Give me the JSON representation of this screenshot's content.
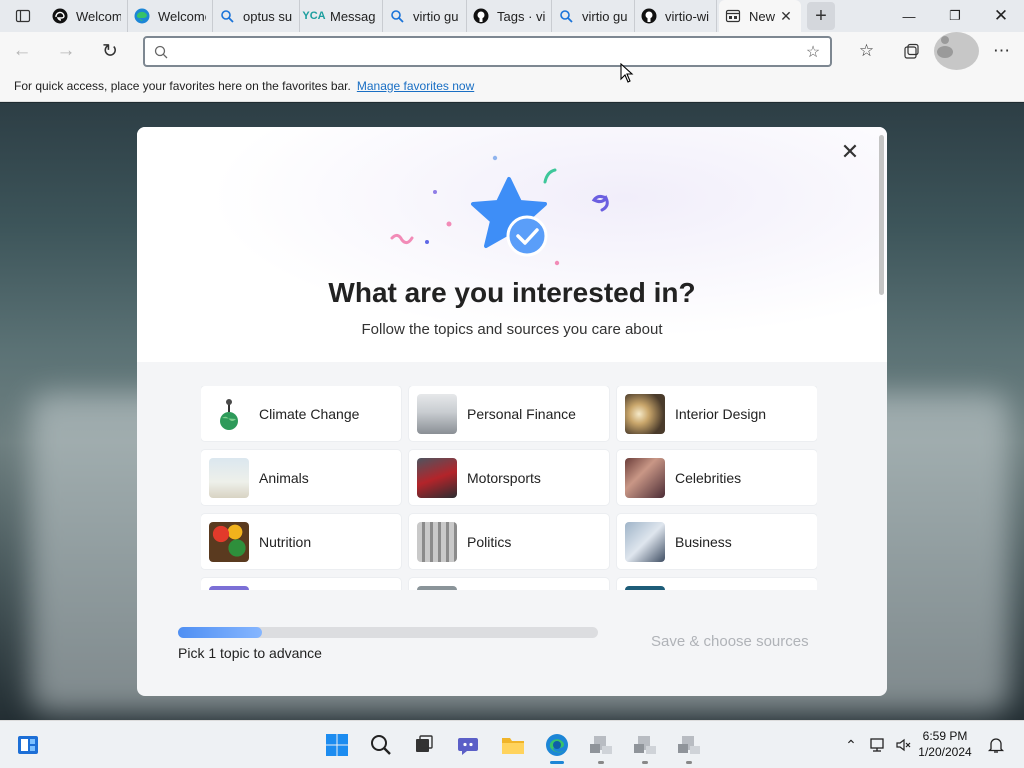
{
  "tabs": [
    {
      "title": "Welcome",
      "favicon": "edge-dev-icon"
    },
    {
      "title": "Welcome",
      "favicon": "edge-icon"
    },
    {
      "title": "optus su",
      "favicon": "search-icon"
    },
    {
      "title": "Message",
      "favicon": "yca-icon"
    },
    {
      "title": "virtio gu",
      "favicon": "search-icon"
    },
    {
      "title": "Tags · vir",
      "favicon": "github-icon"
    },
    {
      "title": "virtio gu",
      "favicon": "search-icon"
    },
    {
      "title": "virtio-wi",
      "favicon": "github-icon"
    }
  ],
  "active_tab": {
    "title": "New",
    "favicon": "newtab-icon"
  },
  "address_bar": {
    "value": "",
    "placeholder": ""
  },
  "favorites_bar": {
    "message": "For quick access, place your favorites here on the favorites bar.",
    "link": "Manage favorites now"
  },
  "modal": {
    "title": "What are you interested in?",
    "subtitle": "Follow the topics and sources you care about",
    "topics": [
      {
        "name": "Climate Change",
        "thumb": "climate"
      },
      {
        "name": "Personal Finance",
        "thumb": "finance"
      },
      {
        "name": "Interior Design",
        "thumb": "interior"
      },
      {
        "name": "Animals",
        "thumb": "animals"
      },
      {
        "name": "Motorsports",
        "thumb": "motorsports"
      },
      {
        "name": "Celebrities",
        "thumb": "celebrities"
      },
      {
        "name": "Nutrition",
        "thumb": "nutrition"
      },
      {
        "name": "Politics",
        "thumb": "politics"
      },
      {
        "name": "Business",
        "thumb": "business"
      },
      {
        "name": "",
        "thumb": "purple"
      },
      {
        "name": "",
        "thumb": "gray"
      },
      {
        "name": "",
        "thumb": "teal"
      }
    ],
    "progress_fraction": 0.2,
    "pick_text": "Pick 1 topic to advance",
    "save_label": "Save & choose sources"
  },
  "colors": {
    "accent": "#1a6fc4",
    "progress": "#4f8ff3",
    "star": "#3e8ef7",
    "disabled_text": "#b0b3b8"
  },
  "taskbar": {
    "time": "6:59 PM",
    "date": "1/20/2024"
  }
}
